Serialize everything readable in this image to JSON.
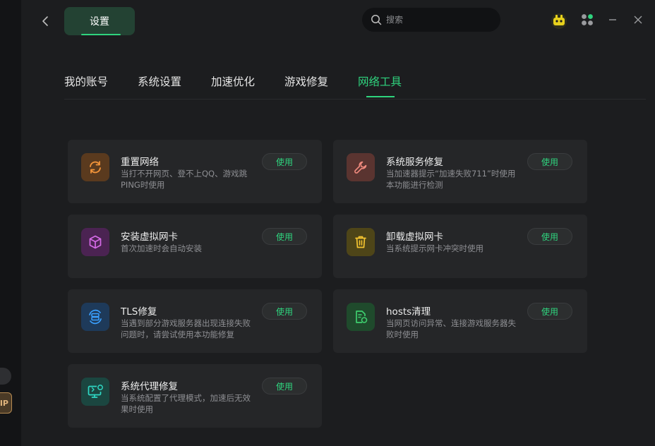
{
  "app": {
    "title": "设置"
  },
  "search": {
    "placeholder": "搜索",
    "value": ""
  },
  "sidebar_strip": {
    "vip_label": "IP"
  },
  "tabs": [
    {
      "label": "我的账号",
      "active": false
    },
    {
      "label": "系统设置",
      "active": false
    },
    {
      "label": "加速优化",
      "active": false
    },
    {
      "label": "游戏修复",
      "active": false
    },
    {
      "label": "网络工具",
      "active": true
    }
  ],
  "tools": [
    {
      "title": "重置网络",
      "desc": "当打不开网页、登不上QQ、游戏跳PING时使用",
      "button": "使用",
      "icon": "refresh-icon",
      "icon_bg": "#5a3a1e",
      "icon_color": "#f2943a"
    },
    {
      "title": "系统服务修复",
      "desc": "当加速器提示“加速失败711”时使用本功能进行检测",
      "button": "使用",
      "icon": "wrench-icon",
      "icon_bg": "#5a3430",
      "icon_color": "#f08a7e"
    },
    {
      "title": "安装虚拟网卡",
      "desc": "首次加速时会自动安装",
      "button": "使用",
      "icon": "cube-icon",
      "icon_bg": "#4b2352",
      "icon_color": "#d56ae6"
    },
    {
      "title": "卸载虚拟网卡",
      "desc": "当系统提示网卡冲突时使用",
      "button": "使用",
      "icon": "trash-icon",
      "icon_bg": "#4e4518",
      "icon_color": "#f4c430"
    },
    {
      "title": "TLS修复",
      "desc": "当遇到部分游戏服务器出现连接失败问题时，请尝试使用本功能修复",
      "button": "使用",
      "icon": "server-refresh-icon",
      "icon_bg": "#1e3a5a",
      "icon_color": "#3aa0ff"
    },
    {
      "title": "hosts清理",
      "desc": "当网页访问异常、连接游戏服务器失败时使用",
      "button": "使用",
      "icon": "document-refresh-icon",
      "icon_bg": "#1f4a2c",
      "icon_color": "#3ecf6e"
    },
    {
      "title": "系统代理修复",
      "desc": "当系统配置了代理模式，加速后无效果时使用",
      "button": "使用",
      "icon": "monitor-refresh-icon",
      "icon_bg": "#1b4640",
      "icon_color": "#2fd8c4"
    }
  ],
  "colors": {
    "accent": "#2fd47e",
    "background": "#1c1d1f",
    "card": "#252628"
  }
}
